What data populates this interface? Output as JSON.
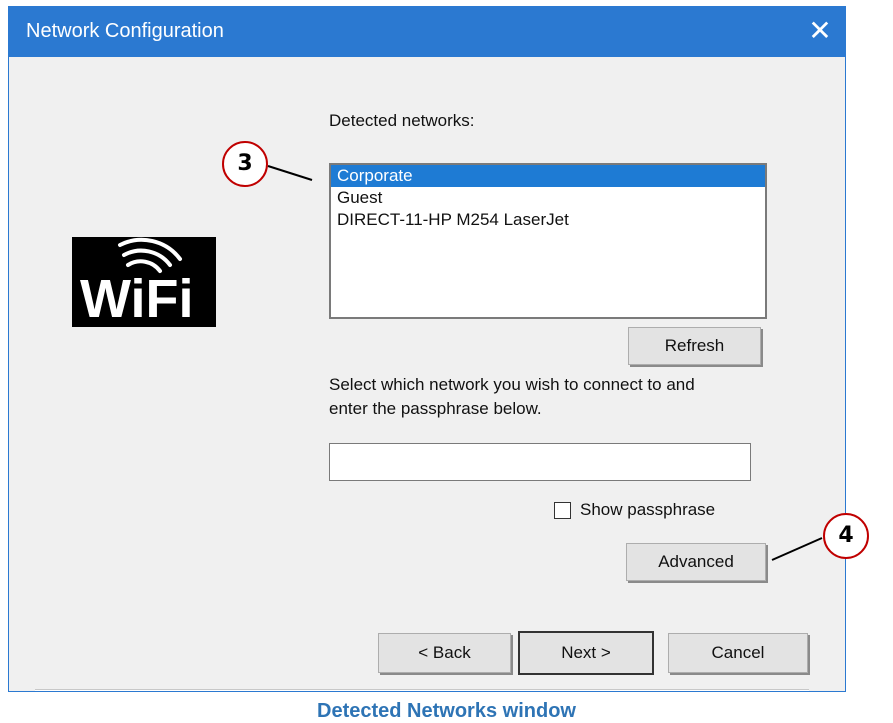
{
  "window": {
    "title": "Network Configuration",
    "close_glyph": "✕"
  },
  "logo": {
    "text": "WiFi",
    "icon": "wifi-logo"
  },
  "networks": {
    "label": "Detected networks:",
    "items": [
      "Corporate",
      "Guest",
      "DIRECT-11-HP M254 LaserJet"
    ],
    "selected_index": 0,
    "refresh_label": "Refresh"
  },
  "passphrase": {
    "instructions_line1": "Select which network you wish to connect to and",
    "instructions_line2": "enter the passphrase below.",
    "value": "",
    "show_label": "Show passphrase",
    "show_checked": false
  },
  "advanced_label": "Advanced",
  "nav": {
    "back_label": "< Back",
    "next_label": "Next >",
    "cancel_label": "Cancel"
  },
  "callouts": {
    "callout_3": "3",
    "callout_4": "4"
  },
  "caption": "Detected Networks window",
  "colors": {
    "titlebar": "#2b79d1",
    "selection": "#1e7bd4",
    "callout_border": "#c00000",
    "caption": "#2e74b5"
  }
}
